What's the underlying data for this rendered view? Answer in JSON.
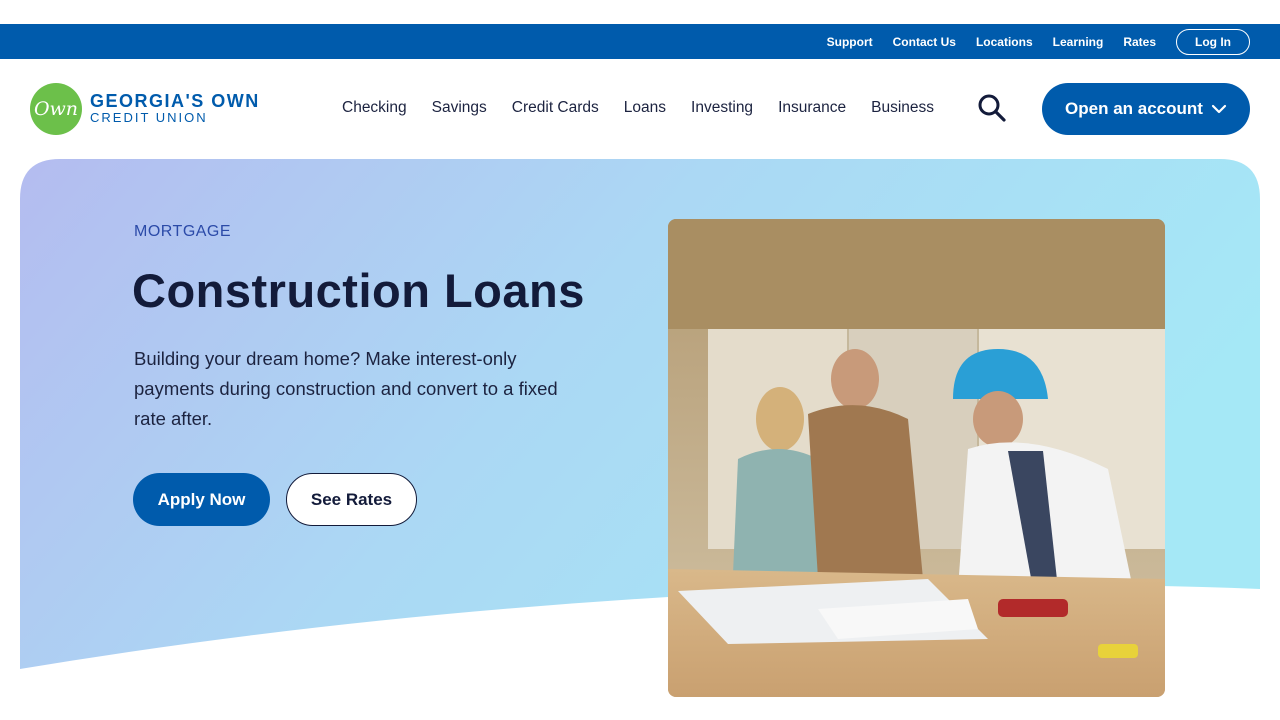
{
  "utility_nav": {
    "links": [
      "Support",
      "Contact Us",
      "Locations",
      "Learning",
      "Rates"
    ],
    "login_label": "Log In"
  },
  "logo": {
    "mark": "Own",
    "name": "GEORGIA'S OWN",
    "sub": "CREDIT UNION"
  },
  "main_nav": {
    "items": [
      "Checking",
      "Savings",
      "Credit Cards",
      "Loans",
      "Investing",
      "Insurance",
      "Business"
    ],
    "search_icon": "search-icon",
    "open_account_label": "Open an account",
    "open_account_icon": "chevron-down-icon"
  },
  "hero": {
    "eyebrow": "MORTGAGE",
    "title": "Construction Loans",
    "description": "Building your dream home? Make interest-only payments during construction and convert to a fixed rate after.",
    "apply_label": "Apply Now",
    "rates_label": "See Rates"
  },
  "colors": {
    "brand_blue": "#005bac",
    "logo_green": "#6cc04a",
    "heading_navy": "#131b3a",
    "gradient_start": "#b3bdf0",
    "gradient_end": "#a6e6f5"
  }
}
